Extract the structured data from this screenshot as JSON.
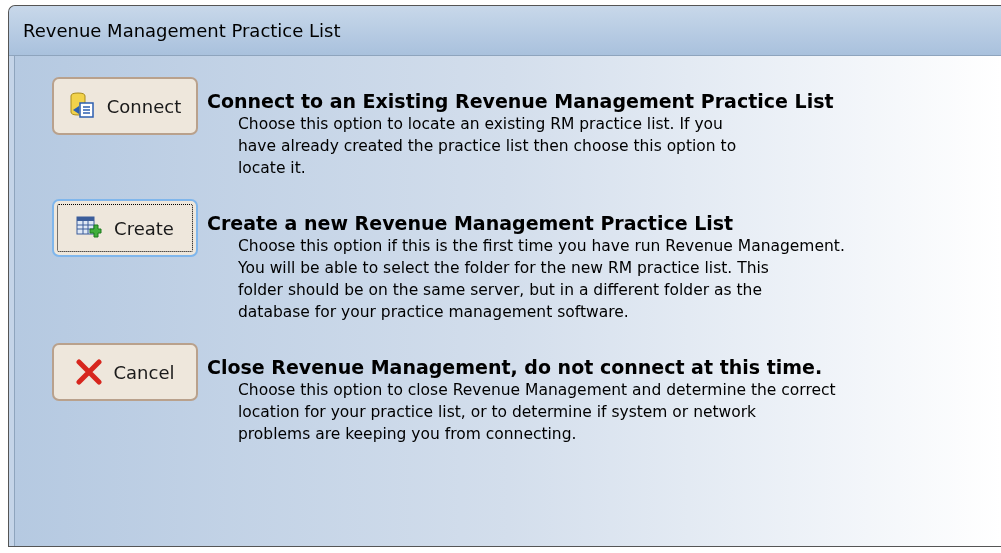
{
  "window": {
    "title": "Revenue Management Practice List"
  },
  "options": [
    {
      "kind": "connect",
      "button": "Connect",
      "focused": false,
      "heading": "Connect to an Existing Revenue Management Practice List",
      "lines": [
        "Choose this option to locate an existing RM practice list. If you",
        "have already created the practice list then choose this option to",
        "locate it."
      ]
    },
    {
      "kind": "create",
      "button": "Create",
      "focused": true,
      "heading": "Create a new Revenue Management Practice List",
      "lines": [
        "Choose this option if this is the first time you have run Revenue Management.",
        "You will be able to select the folder for the new RM practice list. This",
        "folder should be on the same server, but in a different folder as the",
        "database for your practice management software."
      ]
    },
    {
      "kind": "cancel",
      "button": "Cancel",
      "focused": false,
      "heading": "Close Revenue Management, do not connect at this time.",
      "lines": [
        "Choose this option to close Revenue Management and determine the correct",
        "location for your practice list, or to determine if system or network",
        "problems are keeping you from connecting."
      ]
    }
  ]
}
